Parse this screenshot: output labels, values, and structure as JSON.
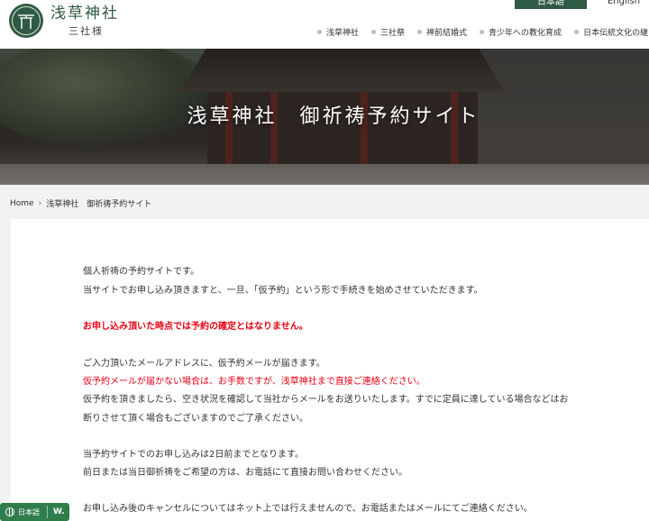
{
  "header": {
    "logo_title": "浅草神社",
    "logo_subtitle": "三社様",
    "lang_japanese": "日本語",
    "lang_english": "English",
    "nav": [
      {
        "label": "浅草神社"
      },
      {
        "label": "三社祭"
      },
      {
        "label": "神前結婚式"
      },
      {
        "label": "青少年への教化育成"
      },
      {
        "label": "日本伝統文化の継"
      }
    ]
  },
  "hero": {
    "title": "浅草神社　御祈祷予約サイト"
  },
  "breadcrumb": {
    "home": "Home",
    "current": "浅草神社　御祈祷予約サイト"
  },
  "content": {
    "p1_l1": "個人祈祷の予約サイトです。",
    "p1_l2": "当サイトでお申し込み頂きますと、一旦、「仮予約」という形で手続きを始めさせていただきます。",
    "warning": "お申し込み頂いた時点では予約の確定とはなりません。",
    "p2_l1": "ご入力頂いたメールアドレスに、仮予約メールが届きます。",
    "p2_l2_red": "仮予約メールが届かない場合は、お手数ですが、浅草神社まで直接ご連絡ください。",
    "p2_l3": "仮予約を頂きましたら、空き状況を確認して当社からメールをお送りいたします。すでに定員に達している場合などはお",
    "p2_l4": "断りさせて頂く場合もございますのでご了承ください。",
    "p3_l1": "当予約サイトでのお申し込みは2日前までとなります。",
    "p3_l2": "前日または当日御祈祷をご希望の方は、お電話にて直接お問い合わせください。",
    "p4_l1": "お申し込み後のキャンセルについてはネット上では行えませんので、お電話またはメールにてご連絡ください。"
  },
  "lang_widget": {
    "label": "日本語",
    "brand": "W."
  },
  "colors": {
    "brand_green": "#2f5a43",
    "warning_red": "#e60012"
  }
}
